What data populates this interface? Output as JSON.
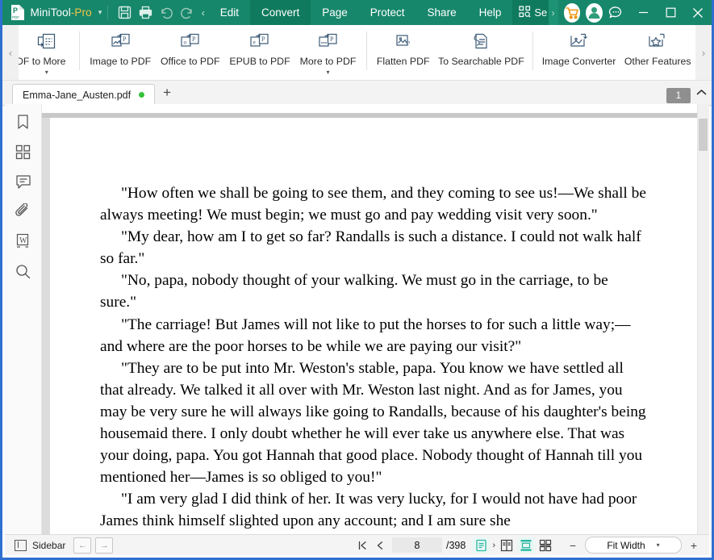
{
  "titlebar": {
    "logo_icon": "pdf-logo-icon",
    "brand_main": "MiniTool",
    "brand_suffix": "-Pro",
    "brand_caret": "▾",
    "quick_actions": [
      {
        "name": "save-button",
        "icon": "save-icon"
      },
      {
        "name": "print-button",
        "icon": "print-icon"
      },
      {
        "name": "undo-button",
        "icon": "undo-icon"
      },
      {
        "name": "redo-button",
        "icon": "redo-icon"
      }
    ],
    "menu_scroll_left": "‹",
    "menu_scroll_right": "›",
    "menu_tabs": [
      {
        "label": "Edit",
        "active": false
      },
      {
        "label": "Convert",
        "active": true
      },
      {
        "label": "Page",
        "active": false
      },
      {
        "label": "Protect",
        "active": false
      },
      {
        "label": "Share",
        "active": false
      },
      {
        "label": "Help",
        "active": false
      }
    ],
    "search_label": "Se",
    "search_icon": "scan-search-icon",
    "cart_icon": "cart-icon",
    "account_icon": "user-avatar-icon",
    "feedback_icon": "chat-bubble-icon",
    "minimize": "—",
    "maximize": "▢",
    "close": "✕"
  },
  "ribbon": {
    "nav_left": "‹",
    "nav_right": "›",
    "items": [
      {
        "label": "DF to More",
        "icon": "pdf-to-more-icon",
        "dropdown": "▾",
        "clipped": true
      },
      {
        "label": "Image to PDF",
        "icon": "image-to-pdf-icon",
        "dropdown": ""
      },
      {
        "label": "Office to PDF",
        "icon": "office-to-pdf-icon",
        "dropdown": ""
      },
      {
        "label": "EPUB to PDF",
        "icon": "epub-to-pdf-icon",
        "dropdown": ""
      },
      {
        "label": "More to PDF",
        "icon": "more-to-pdf-icon",
        "dropdown": "▾"
      },
      {
        "label": "Flatten PDF",
        "icon": "flatten-pdf-icon",
        "dropdown": ""
      },
      {
        "label": "To Searchable PDF",
        "icon": "to-searchable-pdf-icon",
        "dropdown": ""
      },
      {
        "label": "Image Converter",
        "icon": "image-converter-icon",
        "dropdown": ""
      },
      {
        "label": "Other Features",
        "icon": "other-features-icon",
        "dropdown": ""
      }
    ]
  },
  "tabstrip": {
    "document_name": "Emma-Jane_Austen.pdf",
    "modified_dot": true,
    "new_tab": "+",
    "page_badge": "1",
    "collapse_ribbon": "⌃"
  },
  "sidebar_rail": {
    "items": [
      {
        "name": "bookmark-icon",
        "label": "Bookmarks"
      },
      {
        "name": "thumbnails-icon",
        "label": "Thumbnails"
      },
      {
        "name": "comment-icon",
        "label": "Comments"
      },
      {
        "name": "attachment-icon",
        "label": "Attachments"
      },
      {
        "name": "word-icon",
        "label": "Word"
      },
      {
        "name": "search-icon",
        "label": "Search"
      }
    ]
  },
  "document": {
    "paragraphs": [
      "\"How often we shall be going to see them, and they coming to see us!—We shall be always meeting! We must begin; we must go and pay wedding visit very soon.\"",
      "\"My dear, how am I to get so far? Randalls is such a distance. I could not walk half so far.\"",
      "\"No, papa, nobody thought of your walking. We must go in the carriage, to be sure.\"",
      "\"The carriage! But James will not like to put the horses to for such a little way;—and where are the poor horses to be while we are paying our visit?\"",
      "\"They are to be put into Mr. Weston's stable, papa. You know we have settled all that already. We talked it all over with Mr. Weston last night. And as for James, you may be very sure he will always like going to Randalls, because of his daughter's being housemaid there. I only doubt whether he will ever take us anywhere else. That was your doing, papa. You got Hannah that good place. Nobody thought of Hannah till you mentioned her—James is so obliged to you!\"",
      "\"I am very glad I did think of her. It was very lucky, for I would not have had poor James think himself slighted upon any account; and I am sure she"
    ]
  },
  "statusbar": {
    "sidebar_label": "Sidebar",
    "sidebar_icon": "panel-toggle-icon",
    "prev_arrow": "←",
    "next_arrow": "→",
    "first_page_icon": "first-page-icon",
    "prev_page_icon": "prev-page-icon",
    "current_page": "8",
    "total_pages": "/398",
    "view_modes": [
      {
        "name": "single-page-view",
        "selected": true
      },
      {
        "name": "two-page-view",
        "selected": false
      },
      {
        "name": "continuous-scroll-view",
        "selected": true
      },
      {
        "name": "facing-scroll-view",
        "selected": false
      }
    ],
    "separator_glyph": "›",
    "zoom_out": "−",
    "zoom_level": "Fit Width",
    "zoom_caret": "▾",
    "zoom_in": "+"
  },
  "colors": {
    "brand_green": "#17876b",
    "brand_green_active": "#0f7a5e",
    "accent_gold": "#f4c445",
    "window_border_blue": "#2f6fd0",
    "modified_dot_green": "#34c13a",
    "teal_selected": "#2bb8a3"
  }
}
